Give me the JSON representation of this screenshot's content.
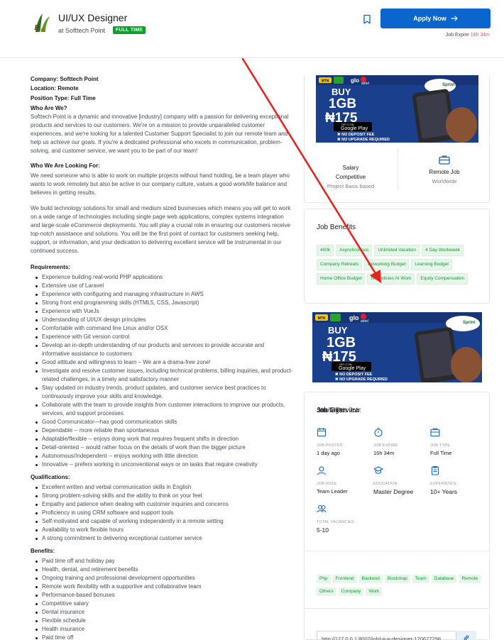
{
  "header": {
    "job_title": "UI/UX Designer",
    "company_prefix": "at Softtech Point",
    "job_type_badge": "FULL TIME",
    "apply_label": "Apply Now",
    "expire_label": "Job Expire",
    "expire_value": "16h 34m"
  },
  "details": {
    "company": "Company: Softtech Point",
    "location": "Location: Remote",
    "position": "Position Type: Full Time",
    "who_heading": "Who Are We?",
    "who_text": "Softtech Point is a dynamic and innovative [industry] company with a passion for delivering exceptional products and services to our customers. We're on a mission to provide unparalleled customer experiences, and we're looking for a talented Customer Support Specialist to join our remote team and help us achieve our goals. If you're a dedicated professional who excels in communication, problem-solving, and customer service, we want you to be part of our team!",
    "looking_heading": "Who We Are Looking For:",
    "looking_text": "We need someone who is able to work on multiple projects without hand holding, be a team player who wants to work remotely but also be active in our company culture, values a good work/life balance and believes in getting results.",
    "build_text": "We build technology solutions for small and medium sized businesses which means you will get to work on a wide range of technologies including single page web applications, complex systems integration and large-scale eCommerce deployments. You will play a crucial role in ensuring our customers receive top-notch assistance and solutions. You will be the first point of contact for customers seeking help, support, or information, and your dedication to delivering excellent service will be instrumental in our continued success.",
    "requirements_heading": "Requirements:",
    "requirements": [
      "Experience building real-world PHP applications",
      "Extensive use of Laravel",
      "Experience with configuring and managing infrastructure in AWS",
      "Strong front end programming skills (HTML5, CSS, Javascript)",
      "Experience with VueJs",
      "Understanding of UI/UX design principles",
      "Comfortable with command line Linux and/or OSX",
      "Experience with Git version control",
      "Develop an in-depth understanding of our products and services to provide accurate and informative assistance to customers",
      "Good attitude and willingness to learn – We are a drama-free zone!",
      "Investigate and resolve customer issues, including technical problems, billing inquiries, and product-related challenges, in a timely and satisfactory manner",
      "Stay updated on industry trends, product updates, and customer service best practices to continuously improve your skills and knowledge.",
      "Collaborate with the team to provide insights from customer interactions to improve our products, services, and support processes.",
      "Good Communicator—has good communication skills",
      "Dependable -- more reliable than spontaneous",
      "Adaptable/flexible -- enjoys doing work that requires frequent shifts in direction",
      "Detail-oriented -- would rather focus on the details of work than the bigger picture",
      "Autonomous/Independent -- enjoys working with little direction",
      "Innovative -- prefers working in unconventional ways or on tasks that require creativity"
    ],
    "qualifications_heading": "Qualifications:",
    "qualifications": [
      "Excellent written and verbal communication skills in English",
      "Strong problem-solving skills and the ability to think on your feet",
      "Empathy and patience when dealing with customer inquiries and concerns",
      "Proficiency in using CRM software and support tools",
      "Self-motivated and capable of working independently in a remote setting",
      "Availability to work flexible hours",
      "A strong commitment to delivering exceptional customer service"
    ],
    "benefits_heading": "Benefits:",
    "benefits": [
      "Paid time off and holiday pay",
      "Health, dental, and retirement benefits",
      "Ongoing training and professional development opportunities",
      "Remote work flexibility with a supportive and collaborative team",
      "Performance-based bonuses",
      "Competitive salary",
      "Dental insurance",
      "Flexible schedule",
      "Health insurance",
      "Paid time off"
    ]
  },
  "ad": {
    "buy": "BUY",
    "data": "1GB",
    "price": "₦175",
    "get_it_on": "GET IT ON",
    "store": "Google Play",
    "line1": "✖ NO DEPOSIT FEE",
    "line2": "✖ NO UPGRADE REQUIRED",
    "brand1": "MTN",
    "brand2": "glo",
    "brand3": "airtel",
    "sprint": "Sprint"
  },
  "salary": {
    "label": "Salary",
    "value": "Competitive",
    "sub": "Project Basis based",
    "loc_label": "Remote Job",
    "loc_sub": "Worldwide"
  },
  "job_benefits": {
    "title": "Job Benefits",
    "chips": [
      "400k",
      "Asynchronous",
      "Unlimited Vacation",
      "4 Day Workweek",
      "Company Retreats",
      "Coworking Budget",
      "Learning Budget",
      "Home Office Budget",
      "No Policies At Work",
      "Equity Compensation"
    ]
  },
  "overview": {
    "title": "Job Overview",
    "items": [
      {
        "label": "JOB POSTED:",
        "value": "1 day ago"
      },
      {
        "label": "JOB EXPIRE",
        "value": "16h 34m"
      },
      {
        "label": "JOB TYPE",
        "value": "Full Time"
      },
      {
        "label": "JOB ROLE",
        "value": "Team Leader"
      },
      {
        "label": "EDUCATION",
        "value": "Master Degree"
      },
      {
        "label": "EXPERIENCE",
        "value": "10+ Years"
      },
      {
        "label": "TOTAL VACANCIES",
        "value": "5-10"
      }
    ]
  },
  "tags": {
    "title": "Job Tags:",
    "items": [
      "Php",
      "Frontend",
      "Backend",
      "Bootstrap",
      "Team",
      "Database",
      "Remote",
      "Others",
      "Company",
      "Work"
    ]
  },
  "share": {
    "title": "Share This Job:",
    "url": "http://127.0.0.1:8002/job/uiux-designer-170677298"
  },
  "colors": {
    "primary": "#0a65cc",
    "success": "#0ba02c",
    "danger": "#e05151",
    "annotation_arrow": "#e8231f"
  }
}
